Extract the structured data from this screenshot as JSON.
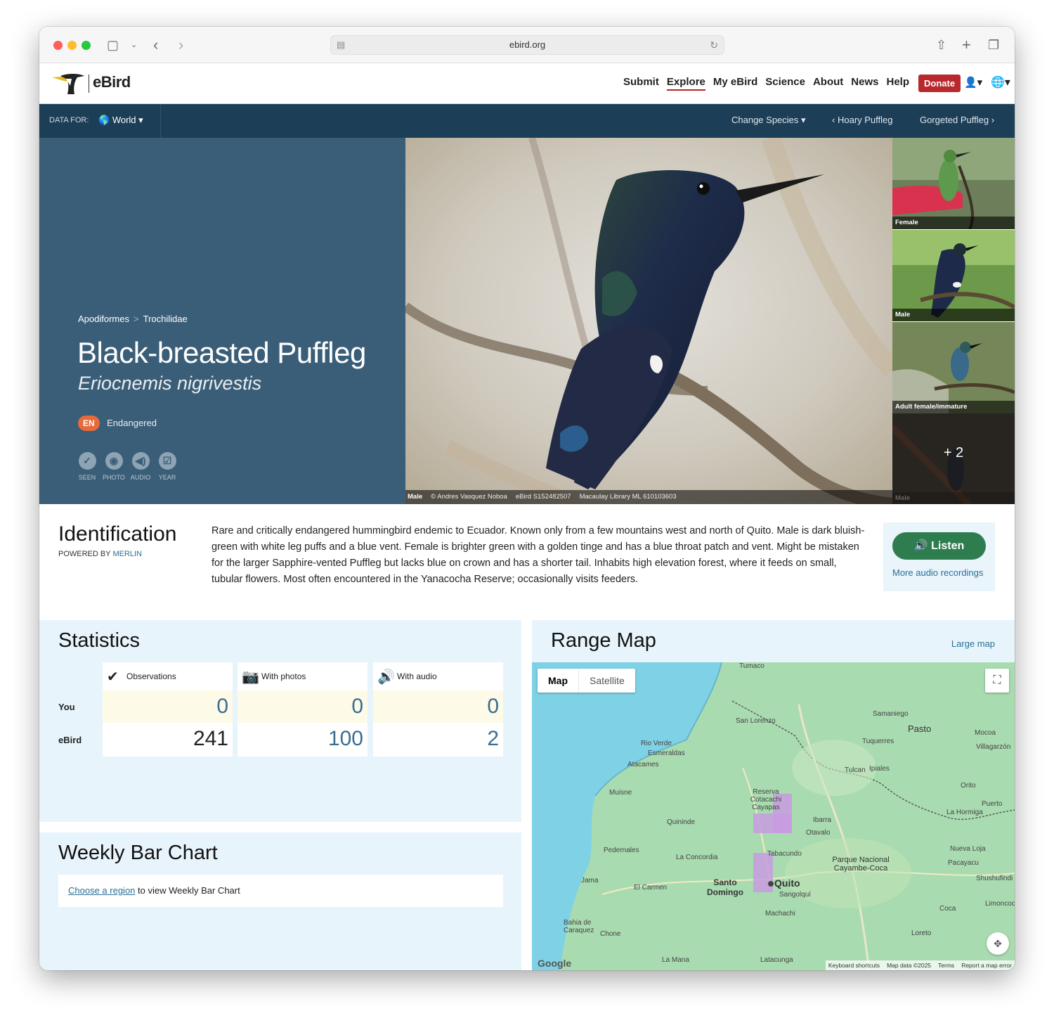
{
  "browser": {
    "url": "ebird.org"
  },
  "header": {
    "logo_text": "eBird",
    "nav": [
      "Submit",
      "Explore",
      "My eBird",
      "Science",
      "About",
      "News",
      "Help"
    ],
    "donate_label": "Donate"
  },
  "databar": {
    "data_for_label": "DATA FOR:",
    "region": "World",
    "change_species": "Change Species",
    "prev_species": "Hoary Puffleg",
    "next_species": "Gorgeted Puffleg"
  },
  "species": {
    "order": "Apodiformes",
    "family": "Trochilidae",
    "common_name": "Black-breasted Puffleg",
    "scientific_name": "Eriocnemis nigrivestis",
    "status_code": "EN",
    "status_label": "Endangered",
    "tracks": [
      "SEEN",
      "PHOTO",
      "AUDIO",
      "YEAR"
    ]
  },
  "main_photo": {
    "sex": "Male",
    "photographer": "© Andres Vasquez Noboa",
    "checklist": "eBird S152482507",
    "catalog": "Macaulay Library ML 610103603"
  },
  "thumbnails": [
    {
      "caption": "Female"
    },
    {
      "caption": "Male"
    },
    {
      "caption": "Adult female/immature"
    },
    {
      "caption": "Male",
      "more": "+ 2"
    }
  ],
  "identification": {
    "title": "Identification",
    "powered_by": "POWERED BY",
    "powered_by_link": "MERLIN",
    "text": "Rare and critically endangered hummingbird endemic to Ecuador. Known only from a few mountains west and north of Quito. Male is dark bluish-green with white leg puffs and a blue vent. Female is brighter green with a golden tinge and has a blue throat patch and vent. Might be mistaken for the larger Sapphire-vented Puffleg but lacks blue on crown and has a shorter tail. Inhabits high elevation forest, where it feeds on small, tubular flowers. Most often encountered in the Yanacocha Reserve; occasionally visits feeders.",
    "listen_label": "Listen",
    "more_audio": "More audio recordings"
  },
  "statistics": {
    "title": "Statistics",
    "row_you": "You",
    "row_ebird": "eBird",
    "columns": [
      {
        "label": "Observations",
        "icon": "check-icon",
        "you": "0",
        "ebird": "241"
      },
      {
        "label": "With photos",
        "icon": "camera-icon",
        "you": "0",
        "ebird": "100"
      },
      {
        "label": "With audio",
        "icon": "speaker-icon",
        "you": "0",
        "ebird": "2"
      }
    ]
  },
  "weekly": {
    "title": "Weekly Bar Chart",
    "link": "Choose a region",
    "text": " to view Weekly Bar Chart"
  },
  "range_map": {
    "title": "Range Map",
    "large_map": "Large map",
    "toggle_map": "Map",
    "toggle_satellite": "Satellite",
    "footer": [
      "Keyboard shortcuts",
      "Map data ©2025",
      "Terms",
      "Report a map error"
    ],
    "google": "Google",
    "places": [
      "Tumaco",
      "San Lorenzo",
      "Samaniego",
      "Pasto",
      "Rio Verde",
      "Esmeraldas",
      "Tuquerres",
      "Atacames",
      "Tulcan",
      "Ipiales",
      "Muisne",
      "Reserva Cotacachi Cayapas",
      "Orito",
      "Puerto",
      "La Hormiga",
      "Quininde",
      "Ibarra",
      "Otavalo",
      "Pedernales",
      "La Concordia",
      "Tabacundo",
      "Parque Nacional Cayambe-Coca",
      "Nueva Loja",
      "Pacayacu",
      "Jama",
      "El Carmen",
      "Santo Domingo",
      "Quito",
      "Sangolquí",
      "Shushufindi",
      "Limoncocha",
      "Coca",
      "Machachi",
      "Bahia de Caraquez",
      "Chone",
      "Loreto",
      "La Mana",
      "Latacunga",
      "Mocoa",
      "Villagarzón"
    ]
  }
}
